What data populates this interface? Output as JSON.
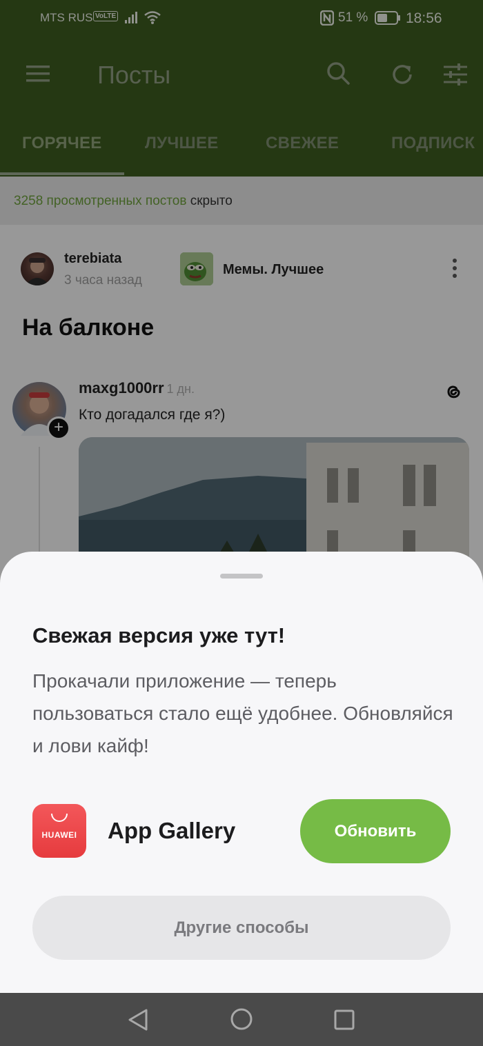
{
  "status_bar": {
    "carrier": "MTS RUS",
    "volte": "VoLTE",
    "battery_percent": "51 %",
    "time": "18:56"
  },
  "app_bar": {
    "title": "Посты",
    "tabs": [
      "ГОРЯЧЕЕ",
      "ЛУЧШЕЕ",
      "СВЕЖЕЕ",
      "ПОДПИСК"
    ],
    "active_tab": 0
  },
  "hidden_info": {
    "count_text": "3258 просмотренных постов",
    "suffix": " скрыто"
  },
  "post": {
    "author": "terebiata",
    "time": "3 часа назад",
    "community": "Мемы. Лучшее",
    "title": "На балконе",
    "embed": {
      "user": "maxg1000rr",
      "age": "1 дн.",
      "text": "Кто догадался где я?)"
    }
  },
  "sheet": {
    "title": "Свежая версия уже тут!",
    "text": "Прокачали приложение — теперь пользоваться стало ещё удобнее. Обновляйся и лови кайф!",
    "store_brand": "HUAWEI",
    "store_name": "App Gallery",
    "update_label": "Обновить",
    "other_label": "Другие способы"
  },
  "colors": {
    "app_bar": "#3d5b1f",
    "accent_green": "#76bb46",
    "store_red": "#e63b3e"
  },
  "icons": [
    "signal-icon",
    "wifi-icon",
    "nfc-icon",
    "battery-icon",
    "menu-icon",
    "search-icon",
    "refresh-icon",
    "filter-icon",
    "more-vert-icon",
    "threads-icon",
    "plus-icon",
    "nav-back-icon",
    "nav-home-icon",
    "nav-recent-icon"
  ]
}
